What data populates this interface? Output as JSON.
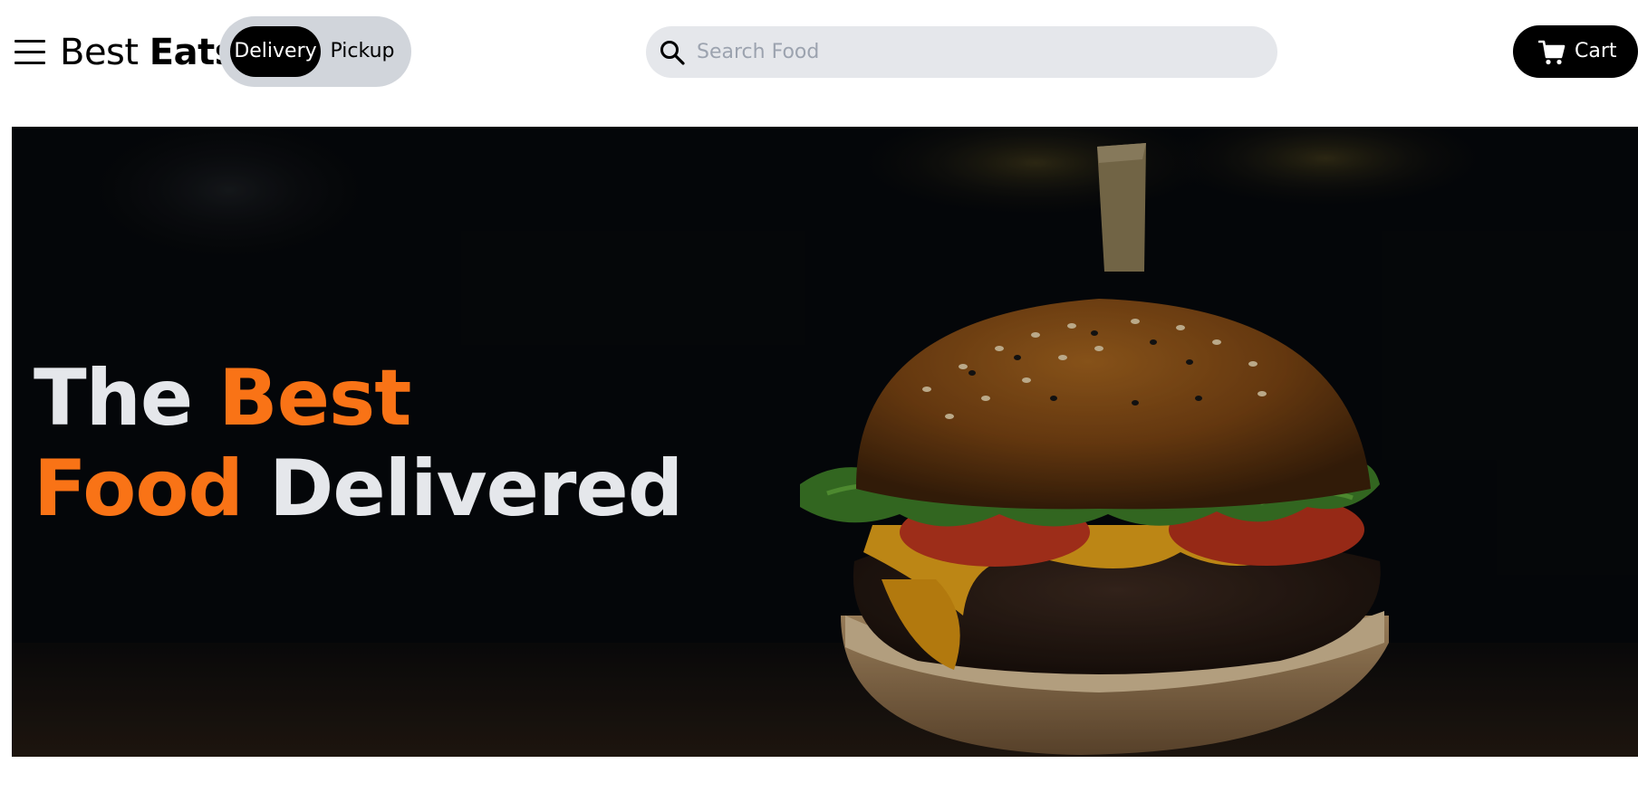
{
  "header": {
    "menu_icon": "hamburger-menu-icon",
    "brand": {
      "part1": "Best",
      "part2": "Eats"
    },
    "toggle": {
      "delivery_label": "Delivery",
      "pickup_label": "Pickup",
      "selected": "Delivery"
    },
    "search": {
      "icon": "search-icon",
      "placeholder": "Search Food",
      "value": ""
    },
    "cart": {
      "icon": "cart-icon",
      "label": "Cart"
    }
  },
  "hero": {
    "image": "burger-photo",
    "title": {
      "word1": "The",
      "word2": "Best",
      "word3": "Food",
      "word4": "Delivered"
    }
  },
  "colors": {
    "accent": "#f97316",
    "toggle_bg": "#d1d5db",
    "search_bg": "#e5e7eb",
    "button_bg": "#000000",
    "hero_text": "#e5e7eb"
  }
}
